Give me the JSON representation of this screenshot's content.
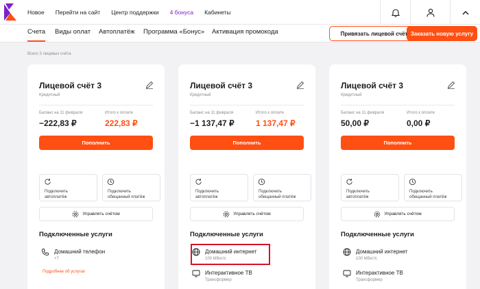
{
  "topnav": {
    "items": [
      "Новое",
      "Перейти на сайт",
      "Центр поддержки",
      "4 бонуса",
      "Кабинеты"
    ]
  },
  "tabs": [
    "Счета",
    "Виды оплат",
    "Автоплатёж",
    "Программа «Бонус»",
    "Активация промокода"
  ],
  "actions": {
    "link_account": "Привязать лицевой счёт",
    "order_service": "Заказать новую услугу"
  },
  "accounts_count": "Всего 3 лицевых счёта",
  "labels": {
    "balance": "Баланс на 11 февраля",
    "to_pay": "Итого к оплате",
    "topup": "Пополнить",
    "autopay": "Подключить\nавтоплатёж",
    "promised": "Подключить\nобещанный платёж",
    "manage": "Управлять счётом",
    "services": "Подключенные услуги",
    "details": "Подробнее об услугах"
  },
  "cards": [
    {
      "title": "Лицевой счёт 3",
      "type": "Кредитный",
      "balance": "−222,83 ₽",
      "to_pay": "222,83 ₽",
      "services": [
        {
          "icon": "phone-icon",
          "name": "Домашний телефон",
          "sub": "+7"
        }
      ]
    },
    {
      "title": "Лицевой счёт 3",
      "type": "Кредитный",
      "balance": "−1 137,47 ₽",
      "to_pay": "1 137,47 ₽",
      "services": [
        {
          "icon": "globe-icon",
          "name": "Домашний интернет",
          "sub": "100 Мбит/с"
        },
        {
          "icon": "tv-icon",
          "name": "Интерактивное ТВ",
          "sub": "Трансформер"
        }
      ]
    },
    {
      "title": "Лицевой счёт 3",
      "type": "Кредитный",
      "balance": "50,00 ₽",
      "to_pay": "0,00 ₽",
      "services": [
        {
          "icon": "globe-icon",
          "name": "Домашний интернет",
          "sub": "100 Мбит/с"
        },
        {
          "icon": "tv-icon",
          "name": "Интерактивное ТВ",
          "sub": "Трансформер"
        }
      ]
    }
  ],
  "colors": {
    "accent": "#ff4f12",
    "brand": "#7b22c9",
    "highlight": "#d6112a"
  }
}
